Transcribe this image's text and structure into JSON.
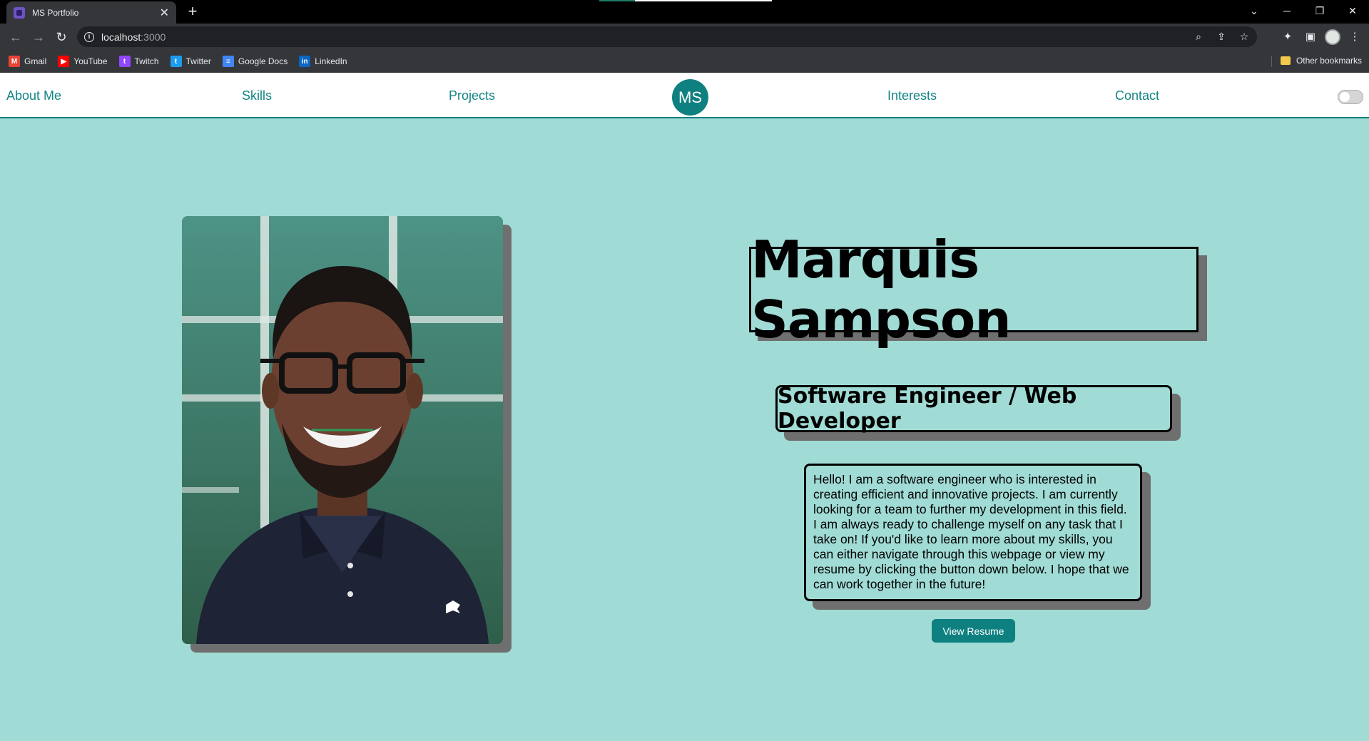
{
  "browser": {
    "tab_title": "MS Portfolio",
    "tab_close": "✕",
    "new_tab": "+",
    "url_host": "localhost",
    "url_port": ":3000",
    "bookmarks": [
      {
        "label": "Gmail",
        "icon": "gmail-icon",
        "color": "#ea4335"
      },
      {
        "label": "YouTube",
        "icon": "youtube-icon",
        "color": "#ff0000"
      },
      {
        "label": "Twitch",
        "icon": "twitch-icon",
        "color": "#9146ff"
      },
      {
        "label": "Twitter",
        "icon": "twitter-icon",
        "color": "#1d9bf0"
      },
      {
        "label": "Google Docs",
        "icon": "google-docs-icon",
        "color": "#4285f4"
      },
      {
        "label": "LinkedIn",
        "icon": "linkedin-icon",
        "color": "#0a66c2"
      }
    ],
    "other_bookmarks": "Other bookmarks"
  },
  "nav": {
    "about": "About Me",
    "skills": "Skills",
    "projects": "Projects",
    "logo": "MS",
    "interests": "Interests",
    "contact": "Contact"
  },
  "hero": {
    "name": "Marquis Sampson",
    "role": "Software Engineer / Web Developer",
    "bio": "Hello! I am a software engineer who is interested in creating efficient and innovative projects. I am currently looking for a team to further my development in this field. I am always ready to challenge myself on any task that I take on! If you'd like to learn more about my skills, you can either navigate through this webpage or view my resume by clicking the button down below. I hope that we can work together in the future!",
    "resume_button": "View Resume"
  },
  "colors": {
    "background": "#a0dbd5",
    "accent": "#0f8080",
    "shadow": "#6f6f6f"
  }
}
